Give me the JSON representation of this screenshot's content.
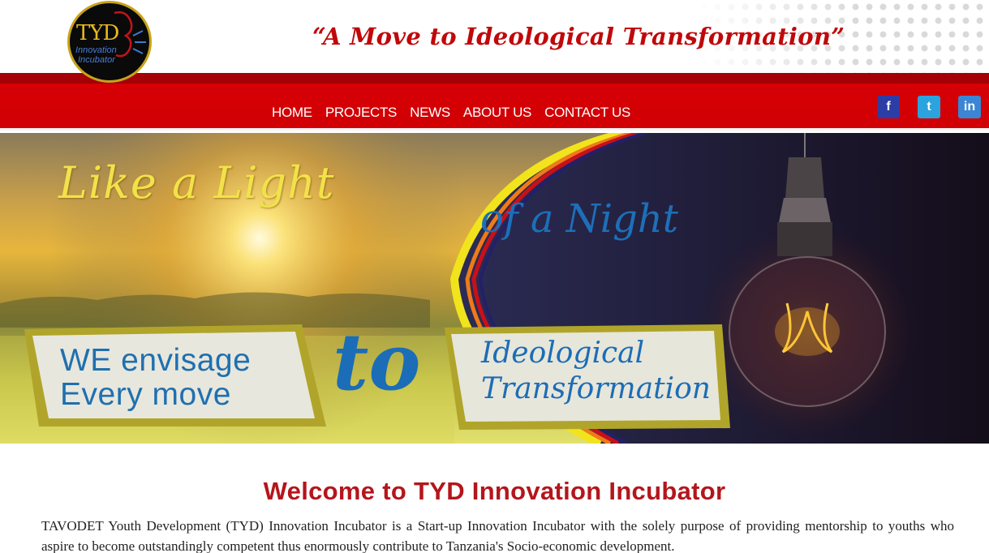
{
  "header": {
    "logo": {
      "abbr": "TYD",
      "line1": "Innovation",
      "line2": "Incubator"
    },
    "tagline": "“A Move to Ideological Transformation”"
  },
  "nav": {
    "items": [
      {
        "label": "HOME"
      },
      {
        "label": "PROJECTS"
      },
      {
        "label": "NEWS"
      },
      {
        "label": "ABOUT US"
      },
      {
        "label": "CONTACT US"
      }
    ]
  },
  "social": [
    {
      "icon": "facebook-icon",
      "glyph": "f"
    },
    {
      "icon": "twitter-icon",
      "glyph": "t"
    },
    {
      "icon": "linkedin-icon",
      "glyph": "in"
    }
  ],
  "hero": {
    "line1": "Like a Light",
    "line2": "of a Night",
    "envisage1": "WE envisage",
    "envisage2": "Every move",
    "to": "to",
    "ideo1": "Ideological",
    "ideo2": "Transformation"
  },
  "content": {
    "title": "Welcome to TYD Innovation Incubator",
    "intro": "TAVODET Youth Development (TYD) Innovation Incubator is a Start-up Innovation Incubator with the solely purpose of providing mentorship to youths who aspire to become outstandingly competent thus enormously contribute to Tanzania's Socio-economic development."
  },
  "colors": {
    "brand_red": "#d00004",
    "tagline_red": "#c0080a",
    "title_red": "#b4161c",
    "hero_blue": "#1c6db7",
    "hero_yellow": "#f2e24a"
  }
}
